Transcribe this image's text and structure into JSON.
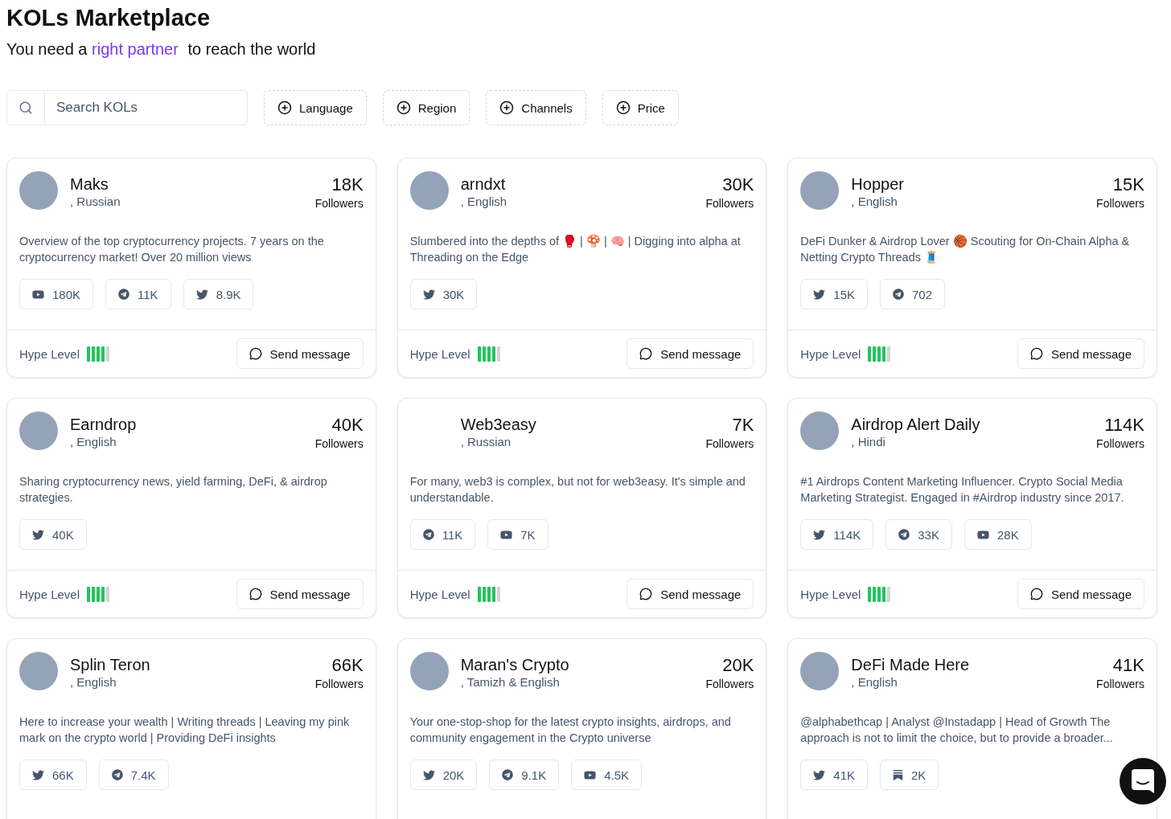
{
  "header": {
    "title": "KOLs Marketplace",
    "tagline_before": "You need a",
    "tagline_highlight": "right partner",
    "tagline_after": "to reach the world"
  },
  "search": {
    "placeholder": "Search KOLs"
  },
  "filters": [
    "Language",
    "Region",
    "Channels",
    "Price"
  ],
  "cards": [
    {
      "name": "Maks",
      "language": ", Russian",
      "avatar": true,
      "followers": "18K",
      "followers_label": "Followers",
      "bio": "Overview of the top cryptocurrency projects. 7 years on the cryptocurrency market! Over 20 million views",
      "channels": [
        {
          "kind": "youtube",
          "count": "180K"
        },
        {
          "kind": "telegram",
          "count": "11K"
        },
        {
          "kind": "twitter",
          "count": "8.9K"
        }
      ],
      "hype_label": "Hype Level",
      "hype": {
        "level": 0.8
      },
      "button": "Send message"
    },
    {
      "name": "arndxt",
      "language": ", English",
      "avatar": true,
      "followers": "30K",
      "followers_label": "Followers",
      "bio": "Slumbered into the depths of 🥊 | 🍄 | 🧠 | Digging into alpha at Threading on the Edge",
      "channels": [
        {
          "kind": "twitter",
          "count": "30K"
        }
      ],
      "hype_label": "Hype Level",
      "hype": {
        "level": 0.8
      },
      "button": "Send message"
    },
    {
      "name": "Hopper",
      "language": ", English",
      "avatar": true,
      "followers": "15K",
      "followers_label": "Followers",
      "bio": "DeFi Dunker & Airdrop Lover 🏀 Scouting for On-Chain Alpha & Netting Crypto Threads 🧵",
      "channels": [
        {
          "kind": "twitter",
          "count": "15K"
        },
        {
          "kind": "telegram",
          "count": "702"
        }
      ],
      "hype_label": "Hype Level",
      "hype": {
        "level": 0.8
      },
      "button": "Send message"
    },
    {
      "name": "Earndrop",
      "language": ", English",
      "avatar": true,
      "followers": "40K",
      "followers_label": "Followers",
      "bio": "Sharing cryptocurrency news, yield farming, DeFi, & airdrop strategies.",
      "channels": [
        {
          "kind": "twitter",
          "count": "40K"
        }
      ],
      "hype_label": "Hype Level",
      "hype": {
        "level": 0.8
      },
      "button": "Send message"
    },
    {
      "name": "Web3easy",
      "language": ", Russian",
      "avatar": false,
      "followers": "7K",
      "followers_label": "Followers",
      "bio": "For many, web3 is complex, but not for web3easy. It's simple and understandable.",
      "channels": [
        {
          "kind": "telegram",
          "count": "11K"
        },
        {
          "kind": "youtube",
          "count": "7K"
        }
      ],
      "hype_label": "Hype Level",
      "hype": {
        "level": 0.8
      },
      "button": "Send message"
    },
    {
      "name": "Airdrop Alert Daily",
      "language": ", Hindi",
      "avatar": true,
      "followers": "114K",
      "followers_label": "Followers",
      "bio": "#1 Airdrops Content Marketing Influencer. Crypto Social Media Marketing Strategist. Engaged in #Airdrop industry since 2017.",
      "channels": [
        {
          "kind": "twitter",
          "count": "114K"
        },
        {
          "kind": "telegram",
          "count": "33K"
        },
        {
          "kind": "youtube",
          "count": "28K"
        }
      ],
      "hype_label": "Hype Level",
      "hype": {
        "level": 0.8
      },
      "button": "Send message"
    },
    {
      "name": "Splin Teron",
      "language": ", English",
      "avatar": true,
      "followers": "66K",
      "followers_label": "Followers",
      "bio": "Here to increase your wealth | Writing threads | Leaving my pink mark on the crypto world | Providing DeFi insights",
      "channels": [
        {
          "kind": "twitter",
          "count": "66K"
        },
        {
          "kind": "telegram",
          "count": "7.4K"
        }
      ]
    },
    {
      "name": "Maran's Crypto",
      "language": ", Tamizh & English",
      "avatar": true,
      "followers": "20K",
      "followers_label": "Followers",
      "bio": "Your one-stop-shop for the latest crypto insights, airdrops, and community engagement in the Crypto universe",
      "channels": [
        {
          "kind": "twitter",
          "count": "20K"
        },
        {
          "kind": "telegram",
          "count": "9.1K"
        },
        {
          "kind": "youtube",
          "count": "4.5K"
        }
      ]
    },
    {
      "name": "DeFi Made Here",
      "language": ", English",
      "avatar": true,
      "followers": "41K",
      "followers_label": "Followers",
      "bio": "@alphabethcap | Analyst @Instadapp | Head of Growth The approach is not to limit the choice, but to provide a broader...",
      "channels": [
        {
          "kind": "twitter",
          "count": "41K"
        },
        {
          "kind": "newsletter",
          "count": "2K"
        }
      ]
    }
  ]
}
